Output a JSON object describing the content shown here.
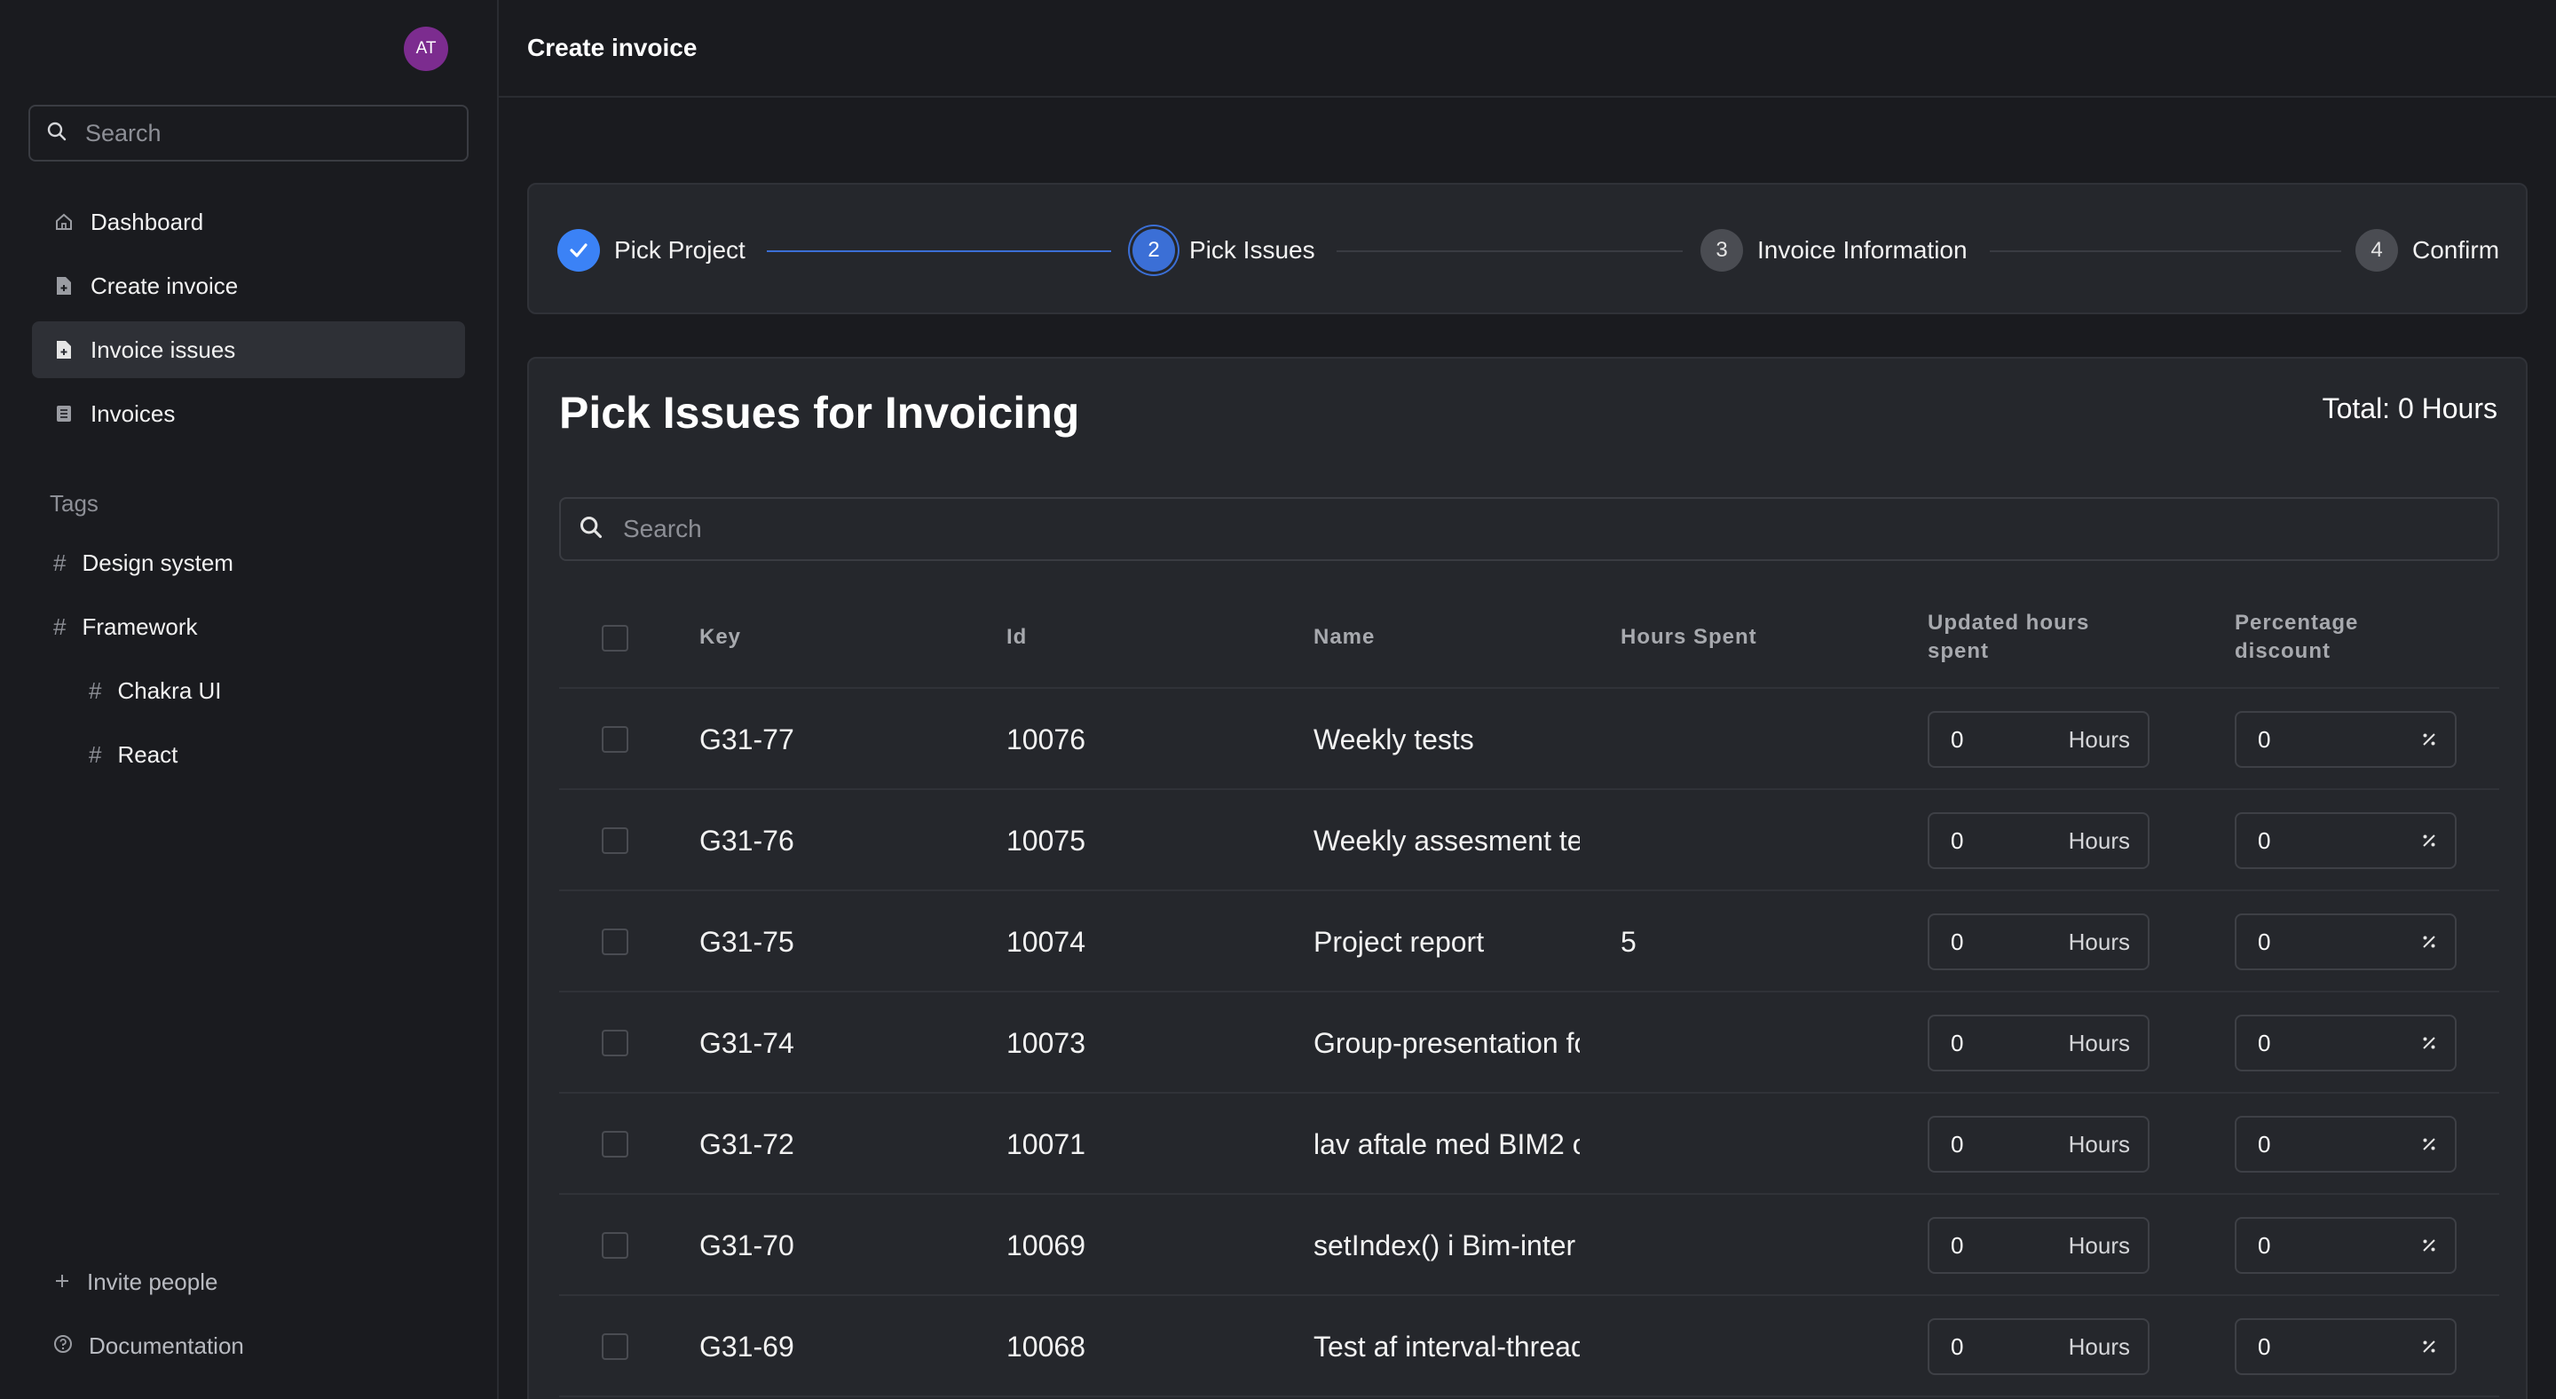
{
  "user": {
    "initials": "AT"
  },
  "sidebar": {
    "search_placeholder": "Search",
    "nav": [
      {
        "label": "Dashboard",
        "icon": "home-icon"
      },
      {
        "label": "Create invoice",
        "icon": "file-plus-icon"
      },
      {
        "label": "Invoice issues",
        "icon": "file-icon",
        "active": true
      },
      {
        "label": "Invoices",
        "icon": "list-icon"
      }
    ],
    "tags_label": "Tags",
    "tags": [
      {
        "label": "Design system"
      },
      {
        "label": "Framework"
      },
      {
        "label": "Chakra UI"
      },
      {
        "label": "React"
      }
    ],
    "invite_label": "Invite people",
    "docs_label": "Documentation"
  },
  "header": {
    "title": "Create invoice"
  },
  "stepper": {
    "steps": [
      {
        "number": "1",
        "label": "Pick Project",
        "state": "done"
      },
      {
        "number": "2",
        "label": "Pick Issues",
        "state": "current"
      },
      {
        "number": "3",
        "label": "Invoice Information",
        "state": "todo"
      },
      {
        "number": "4",
        "label": "Confirm",
        "state": "todo"
      }
    ]
  },
  "main": {
    "title": "Pick Issues for Invoicing",
    "total": "Total: 0 Hours",
    "search_placeholder": "Search",
    "columns": {
      "key": "Key",
      "id": "Id",
      "name": "Name",
      "hours_spent": "Hours Spent",
      "updated_line1": "Updated hours",
      "updated_line2": "spent",
      "discount_line1": "Percentage",
      "discount_line2": "discount"
    },
    "hours_unit": "Hours",
    "percent_symbol": "%",
    "rows": [
      {
        "key": "G31-77",
        "id": "10076",
        "name": "Weekly tests",
        "hours": "",
        "updated": "0",
        "discount": "0"
      },
      {
        "key": "G31-76",
        "id": "10075",
        "name": "Weekly assesment te",
        "hours": "",
        "updated": "0",
        "discount": "0"
      },
      {
        "key": "G31-75",
        "id": "10074",
        "name": "Project report",
        "hours": "5",
        "updated": "0",
        "discount": "0"
      },
      {
        "key": "G31-74",
        "id": "10073",
        "name": "Group-presentation fo",
        "hours": "",
        "updated": "0",
        "discount": "0"
      },
      {
        "key": "G31-72",
        "id": "10071",
        "name": "lav aftale med BIM2 o",
        "hours": "",
        "updated": "0",
        "discount": "0"
      },
      {
        "key": "G31-70",
        "id": "10069",
        "name": "setIndex() i Bim-inter",
        "hours": "",
        "updated": "0",
        "discount": "0"
      },
      {
        "key": "G31-69",
        "id": "10068",
        "name": "Test af interval-thread",
        "hours": "",
        "updated": "0",
        "discount": "0"
      }
    ]
  },
  "colors": {
    "accent": "#3b82f6",
    "background": "#1a1b1f",
    "card": "#25272c",
    "avatar": "#7c2c8f"
  }
}
